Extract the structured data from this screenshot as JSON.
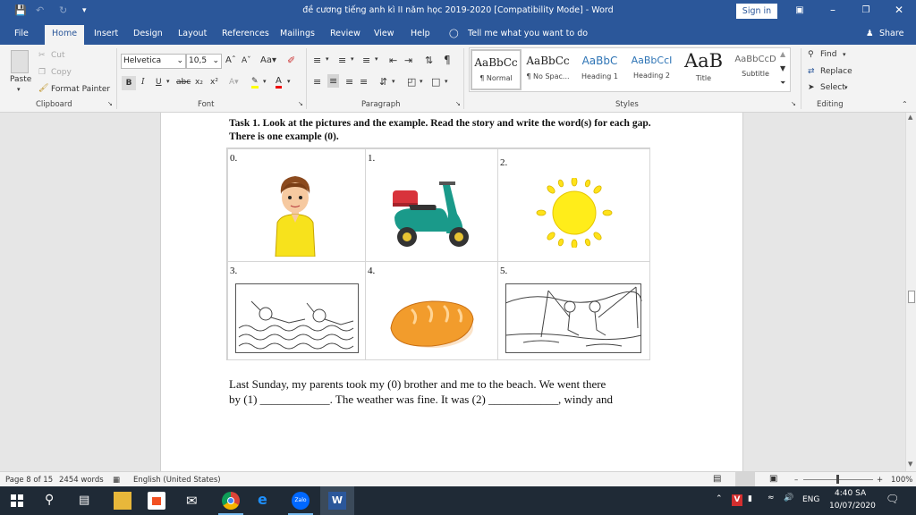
{
  "titlebar": {
    "document_title": "đề cương tiếng anh kì II năm học 2019-2020 [Compatibility Mode]  -  Word",
    "signin_label": "Sign in"
  },
  "menu": {
    "tabs": [
      "File",
      "Home",
      "Insert",
      "Design",
      "Layout",
      "References",
      "Mailings",
      "Review",
      "View",
      "Help"
    ],
    "tell_me": "Tell me what you want to do",
    "share": "Share"
  },
  "ribbon": {
    "clipboard": {
      "paste": "Paste",
      "cut": "Cut",
      "copy": "Copy",
      "format_painter": "Format Painter",
      "label": "Clipboard"
    },
    "font": {
      "name": "Helvetica",
      "size": "10,5",
      "label": "Font"
    },
    "paragraph": {
      "label": "Paragraph"
    },
    "styles": {
      "label": "Styles",
      "items": [
        {
          "preview": "AaBbCc",
          "name": "¶ Normal"
        },
        {
          "preview": "AaBbCc",
          "name": "¶ No Spac..."
        },
        {
          "preview": "AaBbC",
          "name": "Heading 1"
        },
        {
          "preview": "AaBbCcI",
          "name": "Heading 2"
        },
        {
          "preview": "AaB",
          "name": "Title"
        },
        {
          "preview": "AaBbCcD",
          "name": "Subtitle"
        }
      ]
    },
    "editing": {
      "find": "Find",
      "replace": "Replace",
      "select": "Select",
      "label": "Editing"
    }
  },
  "document": {
    "task_heading": "Task 1. Look at the pictures and the example. Read the story and write the word(s) for each gap. There is one example (0).",
    "pictures": [
      {
        "num": "0.",
        "icon": "boy-icon"
      },
      {
        "num": "1.",
        "icon": "motorbike-icon"
      },
      {
        "num": "2.",
        "icon": "sun-icon"
      },
      {
        "num": "3.",
        "icon": "swimming-icon"
      },
      {
        "num": "4.",
        "icon": "bread-icon"
      },
      {
        "num": "5.",
        "icon": "fishing-icon"
      }
    ],
    "story_line1": "Last Sunday, my parents took my (0) brother and me to the beach. We went there",
    "story_line2": "by (1) ____________. The weather was fine. It was (2) ____________, windy and"
  },
  "status": {
    "page": "Page 8 of 15",
    "words": "2454 words",
    "language": "English (United States)",
    "zoom": "100%"
  },
  "taskbar": {
    "time": "4:40 SA",
    "date": "10/07/2020",
    "lang": "ENG",
    "zalo": "Zalo"
  },
  "colors": {
    "word_blue": "#2b579a",
    "taskbar": "#1f2a36"
  }
}
